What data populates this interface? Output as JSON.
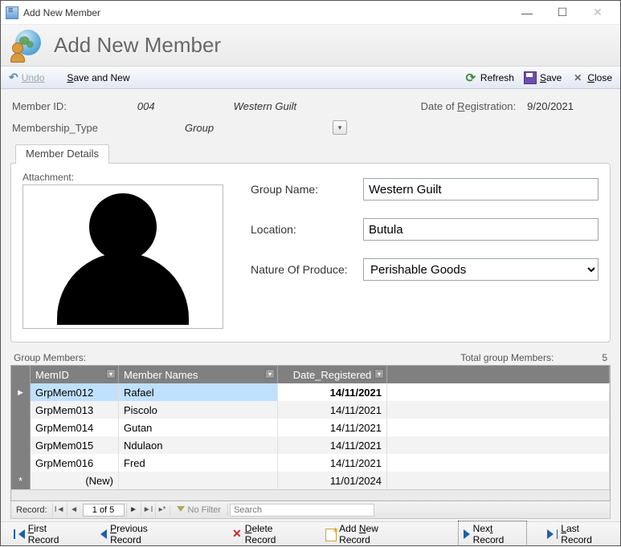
{
  "window": {
    "title": "Add New Member"
  },
  "banner": {
    "heading": "Add New Member"
  },
  "toolbar": {
    "undo": "Undo",
    "saveNew": "Save and New",
    "refresh": "Refresh",
    "save": "Save",
    "close": "Close"
  },
  "header": {
    "memberIdLabel": "Member ID:",
    "memberId": "004",
    "memberName": "Western Guilt",
    "dateRegLabel": "Date of Registration:",
    "dateReg": "9/20/2021",
    "memTypeLabel": "Membership_Type",
    "memType": "Group"
  },
  "tab": {
    "label": "Member Details"
  },
  "details": {
    "attachmentLabel": "Attachment:",
    "groupNameLabel": "Group Name:",
    "groupName": "Western Guilt",
    "locationLabel": "Location:",
    "location": "Butula",
    "natureLabel": "Nature Of Produce:",
    "nature": "Perishable Goods"
  },
  "totals": {
    "groupMembersLabel": "Group Members:",
    "totalLabel": "Total group Members:",
    "totalValue": "5"
  },
  "grid": {
    "columns": {
      "id": "MemID",
      "name": "Member Names",
      "date": "Date_Registered"
    },
    "rows": [
      {
        "id": "GrpMem012",
        "name": "Rafael",
        "date": "14/11/2021",
        "selected": true
      },
      {
        "id": "GrpMem013",
        "name": "Piscolo",
        "date": "14/11/2021"
      },
      {
        "id": "GrpMem014",
        "name": "Gutan",
        "date": "14/11/2021"
      },
      {
        "id": "GrpMem015",
        "name": "Ndulaon",
        "date": "14/11/2021"
      },
      {
        "id": "GrpMem016",
        "name": "Fred",
        "date": "14/11/2021"
      }
    ],
    "newRow": {
      "id": "(New)",
      "name": "",
      "date": "11/01/2024"
    }
  },
  "recnav": {
    "label": "Record:",
    "position": "1 of 5",
    "noFilter": "No Filter",
    "searchPlaceholder": "Search"
  },
  "bottom": {
    "first": "First Record",
    "prev": "Previous Record",
    "del": "Delete Record",
    "add": "Add New Record",
    "next": "Next Record",
    "last": "Last Record"
  }
}
